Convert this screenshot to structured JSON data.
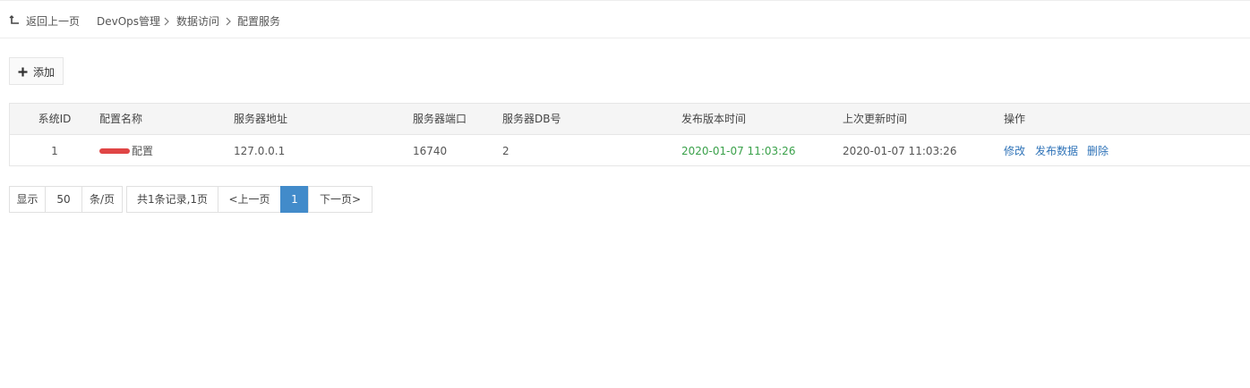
{
  "breadcrumb": {
    "back_label": "返回上一页",
    "crumbs": [
      "DevOps管理",
      "数据访问",
      "配置服务"
    ]
  },
  "toolbar": {
    "add_label": "添加",
    "add_icon": "plus-icon"
  },
  "table": {
    "columns": [
      "系统ID",
      "配置名称",
      "服务器地址",
      "服务器端口",
      "服务器DB号",
      "发布版本时间",
      "上次更新时间",
      "操作"
    ],
    "rows": [
      {
        "system_id": "1",
        "config_name": "配置",
        "server_address": "127.0.0.1",
        "server_port": "16740",
        "db_number": "2",
        "publish_time": "2020-01-07 11:03:26",
        "last_update_time": "2020-01-07 11:03:26",
        "actions": [
          "修改",
          "发布数据",
          "删除"
        ]
      }
    ]
  },
  "pagination": {
    "show_label": "显示",
    "page_size": "50",
    "per_page_label": "条/页",
    "summary": "共1条记录,1页",
    "prev_label": "<上一页",
    "current_page": "1",
    "next_label": "下一页>"
  },
  "colors": {
    "accent": "#428bca",
    "link": "#2f73b8",
    "publish_time": "#3aa14a",
    "redaction": "#e04545"
  }
}
